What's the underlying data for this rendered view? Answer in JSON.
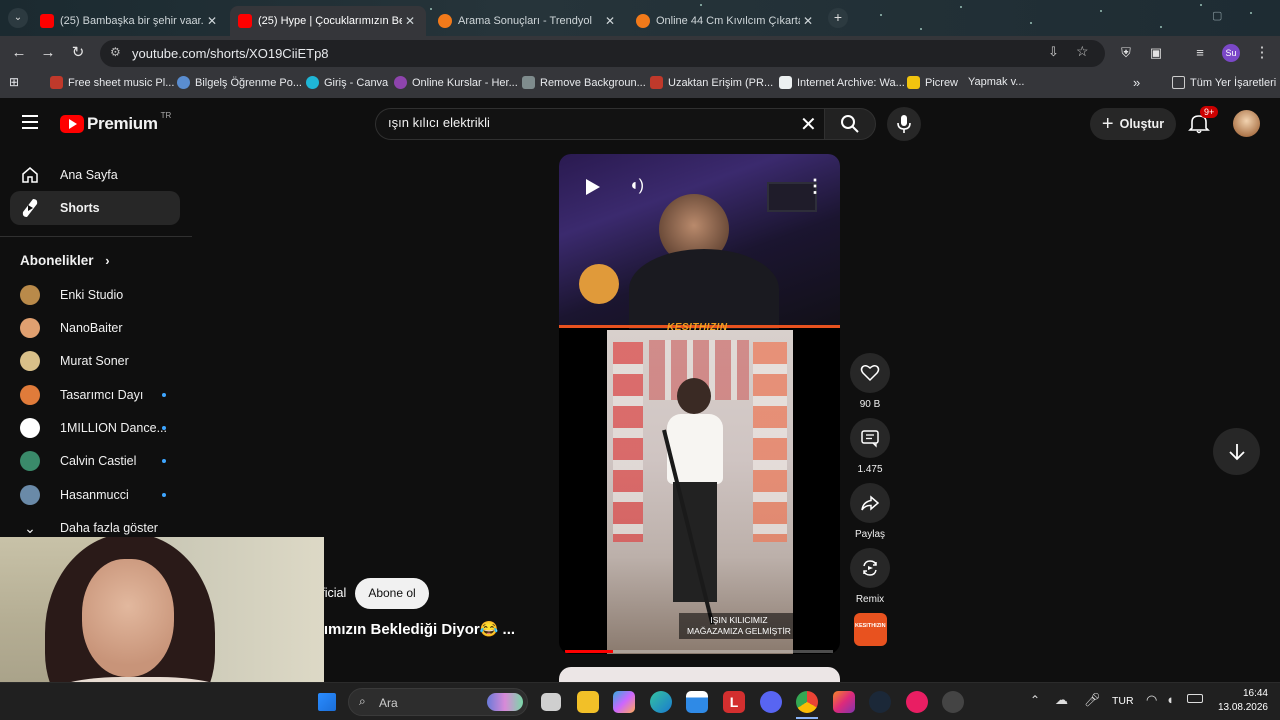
{
  "browser": {
    "tabs": [
      {
        "title": "(25) Bambaşka bir şehir vaar...",
        "active": false
      },
      {
        "title": "(25) Hype | Çocuklarımızın Bekl...",
        "active": true
      },
      {
        "title": "Arama Sonuçları - Trendyol",
        "active": false
      },
      {
        "title": "Online 44 Cm Kıvılcım Çıkartan...",
        "active": false
      }
    ],
    "new_tab": "+",
    "url": "youtube.com/shorts/XO19CiiETp8",
    "profile_badge": "Su",
    "bookmarks": [
      "Free sheet music Pl...",
      "Bilgelş Öğrenme Po...",
      "Giriş - Canva",
      "Online Kurslar - Her...",
      "Remove Backgroun...",
      "Uzaktan Erişim (PR...",
      "Internet Archive: Wa...",
      "Picrew",
      "Yapmak v..."
    ],
    "bookmarks_more": "»",
    "all_bookmarks": "Tüm Yer İşaretleri"
  },
  "youtube": {
    "logo_text": "Premium",
    "logo_region": "TR",
    "search_value": "ışın kılıcı elektrikli",
    "create_label": "Oluştur",
    "notif_badge": "9+",
    "nav": [
      {
        "label": "Ana Sayfa",
        "icon": "home-icon"
      },
      {
        "label": "Shorts",
        "icon": "shorts-icon"
      }
    ],
    "subs_heading": "Abonelikler",
    "subscriptions": [
      {
        "name": "Enki Studio",
        "dot": false,
        "color": "#b98a4a"
      },
      {
        "name": "NanoBaiter",
        "dot": false,
        "color": "#e0a070"
      },
      {
        "name": "Murat Soner",
        "dot": false,
        "color": "#d9c089"
      },
      {
        "name": "Tasarımcı Dayı",
        "dot": true,
        "color": "#e07b3a"
      },
      {
        "name": "1MILLION Dance...",
        "dot": true,
        "color": "#ffffff"
      },
      {
        "name": "Calvin Castiel",
        "dot": true,
        "color": "#3a8a6a"
      },
      {
        "name": "Hasanmucci",
        "dot": true,
        "color": "#6a8aa8"
      }
    ],
    "show_more": "Daha fazla göster",
    "short": {
      "channel_partial": "fficial",
      "subscribe": "Abone ol",
      "title_partial": "rımızın Beklediği Diyor😂 ...",
      "banner_text": "KESITHIZIN",
      "caption_line1": "IŞIN KILICIMIZ",
      "caption_line2": "MAĞAZAMIZA GELMİŞTİR",
      "progress": 0.18
    },
    "actions": {
      "like_count": "90 B",
      "comment_count": "1.475",
      "share_label": "Paylaş",
      "remix_label": "Remix"
    }
  },
  "taskbar": {
    "search_placeholder": "Ara",
    "language": "TUR",
    "time": "16:44",
    "date": "13.08.2026"
  },
  "colors": {
    "yt_red": "#ff0000",
    "badge_red": "#cc0000",
    "accent_orange": "#e8521f",
    "tab_active": "#35363a",
    "link_blue": "#3ea6ff"
  }
}
